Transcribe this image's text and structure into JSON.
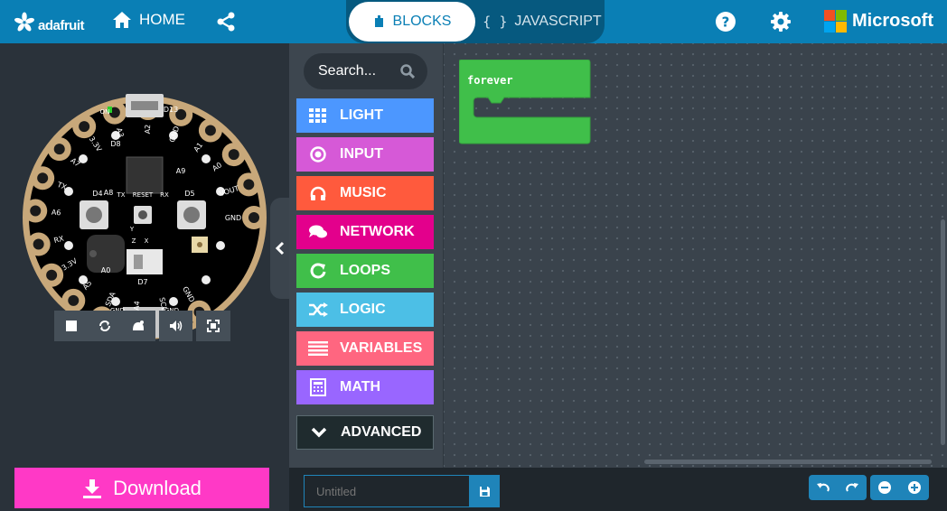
{
  "header": {
    "brand": "adafruit",
    "home_label": "HOME",
    "tabs": [
      {
        "label": "BLOCKS",
        "icon": "puzzle-icon",
        "active": true
      },
      {
        "label": "JAVASCRIPT",
        "icon": "braces-icon",
        "active": false
      }
    ],
    "ms_label": "Microsoft",
    "colors": {
      "bar": "#0a7fb5",
      "tab_bg": "#06597f"
    }
  },
  "board": {
    "pins": [
      {
        "label": "GND"
      },
      {
        "label": "SCL"
      },
      {
        "label": "A4"
      },
      {
        "label": "SDA"
      },
      {
        "label": "A5"
      },
      {
        "label": "3.3V"
      },
      {
        "label": "RX"
      },
      {
        "label": "A6"
      },
      {
        "label": "TX"
      },
      {
        "label": "A7"
      },
      {
        "label": "3.3V"
      },
      {
        "label": "A3"
      },
      {
        "label": "A2"
      },
      {
        "label": "GND"
      },
      {
        "label": "A1"
      },
      {
        "label": "A0"
      },
      {
        "label": "VOUT"
      },
      {
        "label": "GND"
      }
    ],
    "labels": {
      "d13": "D13",
      "d8": "D8",
      "a8": "A8",
      "a9": "A9",
      "d4": "D4",
      "d5": "D5",
      "reset": "RESET",
      "tx": "TX",
      "rx": "RX",
      "d7": "D7",
      "a0": "A0",
      "on": "ON",
      "z": "Z",
      "x": "X",
      "y": "Y",
      "gnd_left": "GND",
      "gnd_right": "GND"
    }
  },
  "sim_controls": [
    "stop-icon",
    "restart-icon",
    "slowmo-icon",
    "mute-icon",
    "fullscreen-icon"
  ],
  "toolbox": {
    "search_placeholder": "Search...",
    "categories": [
      {
        "label": "LIGHT",
        "color": "#4c97ff",
        "icon": "grid-icon"
      },
      {
        "label": "INPUT",
        "color": "#d659d7",
        "icon": "target-icon"
      },
      {
        "label": "MUSIC",
        "color": "#ff5a3d",
        "icon": "headphones-icon"
      },
      {
        "label": "NETWORK",
        "color": "#e3008c",
        "icon": "chat-icon"
      },
      {
        "label": "LOOPS",
        "color": "#40bf4a",
        "icon": "refresh-icon"
      },
      {
        "label": "LOGIC",
        "color": "#4cbfe6",
        "icon": "shuffle-icon"
      },
      {
        "label": "VARIABLES",
        "color": "#ff6680",
        "icon": "list-icon"
      },
      {
        "label": "MATH",
        "color": "#9966ff",
        "icon": "calculator-icon"
      }
    ],
    "advanced_label": "ADVANCED"
  },
  "workspace": {
    "block_label": "forever",
    "block_color": "#40bf4a"
  },
  "footer": {
    "download_label": "Download",
    "project_placeholder": "Untitled",
    "download_color": "#ff39c6"
  }
}
